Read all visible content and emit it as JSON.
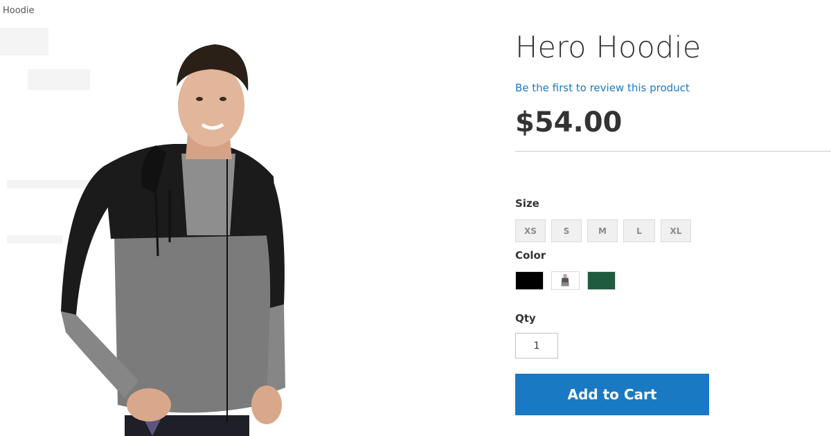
{
  "breadcrumb": {
    "current": "Hoodie"
  },
  "product": {
    "title": "Hero Hoodie",
    "review_link": "Be the first to review this product",
    "price": "$54.00"
  },
  "options": {
    "size_label": "Size",
    "sizes": [
      "XS",
      "S",
      "M",
      "L",
      "XL"
    ],
    "color_label": "Color",
    "colors": [
      {
        "name": "Black",
        "swatch": "#000000"
      },
      {
        "name": "Gray",
        "swatch": "image"
      },
      {
        "name": "Green",
        "swatch": "#1f5b3f"
      }
    ]
  },
  "qty": {
    "label": "Qty",
    "value": "1"
  },
  "cart": {
    "button_label": "Add to Cart"
  },
  "theme": {
    "accent": "#1979c3",
    "text": "#333333"
  }
}
